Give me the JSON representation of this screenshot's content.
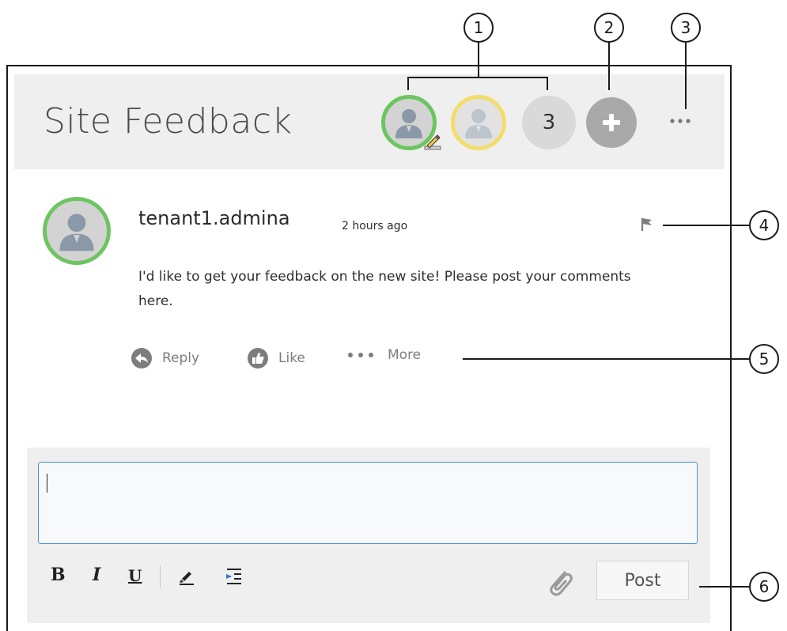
{
  "header": {
    "title": "Site Feedback",
    "participants_more_count": "3"
  },
  "comment": {
    "author": "tenant1.admina",
    "time_ago": "2 hours ago",
    "text": "I'd like to get your feedback on the new site! Please post your comments here.",
    "actions": {
      "reply": "Reply",
      "like": "Like",
      "more": "More"
    }
  },
  "composer": {
    "value": "",
    "toolbar": {
      "bold": "B",
      "italic": "I",
      "underline": "U"
    },
    "post_label": "Post"
  },
  "callouts": [
    "1",
    "2",
    "3",
    "4",
    "5",
    "6"
  ],
  "colors": {
    "active_ring": "#6cc560",
    "pending_ring": "#f2dd6a",
    "editor_border": "#4a8fd8",
    "header_bg": "#efefef"
  }
}
